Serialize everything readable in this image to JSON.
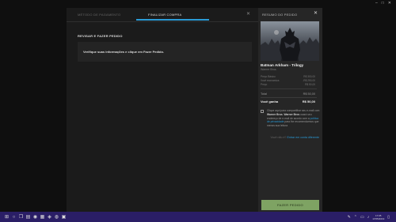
{
  "window_controls": {
    "minimize": "–",
    "maximize": "□",
    "close": "✕"
  },
  "tabs": [
    {
      "label": "MÉTODO DE PAGAMENTO",
      "active": false
    },
    {
      "label": "FINALIZAR COMPRA",
      "active": true
    }
  ],
  "dialog_close": "✕",
  "section_title": "REVISAR E FAZER PEDIDO",
  "info_message": "Verifique suas informações e clique em Fazer Pedido.",
  "summary": {
    "title": "RESUMO DO PEDIDO",
    "close": "✕",
    "game_title": "Batman Arkham - Trilogy",
    "publisher": "Warner Bros.",
    "rows": [
      {
        "label": "Preço Básico",
        "value": "R$ 300,00"
      },
      {
        "label": "Você economiza",
        "value": "-R$ 250,00"
      },
      {
        "label": "Preço",
        "value": "R$ 50,00"
      }
    ],
    "subtotal": {
      "label": "Total",
      "value": "R$ 50,00"
    },
    "total": {
      "label": "Você ganha",
      "value": "R$ 50,00"
    },
    "consent": {
      "text_before": "Clique aqui para compartilhar seu e-mail com",
      "brand1": "Warner Bros",
      "separator": ".",
      "brand2": "Warner Bros",
      "text_middle": "usará seu endereço de e-mail de acordo com a",
      "policy_link": "política de privacidade",
      "text_after": "para lhe recomendarmos que menos sua leitura"
    },
    "other_pay_prefix": "Você não é?",
    "other_pay_link": "Entrar em conta diferente",
    "buy_button": "FAZER PEDIDO"
  },
  "taskbar": {
    "start": "⊞",
    "search": "○",
    "task_view": "❐",
    "apps": [
      "▤",
      "◉",
      "▦",
      "◈",
      "◍",
      "▣"
    ],
    "time": "17:05",
    "date": "17/05/2019",
    "tray": [
      "✎",
      "⌃",
      "▭",
      "♪",
      "▯"
    ]
  },
  "colors": {
    "accent": "#2a9bd7",
    "buy_button": "#7ea363",
    "taskbar": "#2a1e66"
  }
}
